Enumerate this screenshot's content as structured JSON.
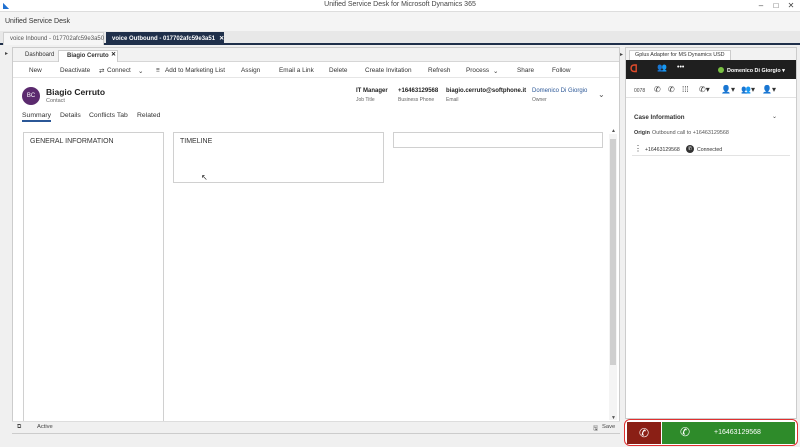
{
  "window": {
    "title": "Unified Service Desk for Microsoft Dynamics 365",
    "app_title": "Unified Service Desk"
  },
  "session_tabs": [
    {
      "label": "voice Inbound - 017702afc59e3a50"
    },
    {
      "label": "voice Outbound - 017702afc59e3a51",
      "close": "✕"
    }
  ],
  "doc_tabs": [
    {
      "label": "Dashboard"
    },
    {
      "label": "Biagio Cerruto",
      "close": "✕"
    }
  ],
  "commands": {
    "new": "New",
    "deactivate": "Deactivate",
    "connect": "Connect",
    "add_marketing": "Add to Marketing List",
    "assign": "Assign",
    "email_link": "Email a Link",
    "delete": "Delete",
    "create_invitation": "Create Invitation",
    "refresh": "Refresh",
    "process": "Process",
    "share": "Share",
    "follow": "Follow"
  },
  "record": {
    "initials": "BC",
    "name": "Biagio Cerruto",
    "type": "Contact",
    "header_fields": [
      {
        "value": "IT Manager",
        "label": "Job Title"
      },
      {
        "value": "+16463129568",
        "label": "Business Phone"
      },
      {
        "value": "biagio.cerruto@softphone.it",
        "label": "Email"
      },
      {
        "value": "Domenico Di Giorgio",
        "label": "Owner"
      }
    ]
  },
  "form_tabs": [
    "Summary",
    "Details",
    "Conflicts Tab",
    "Related"
  ],
  "sections": {
    "general": "GENERAL INFORMATION",
    "timeline": "TIMELINE"
  },
  "status": {
    "state": "Active",
    "save": "Save"
  },
  "right_panel": {
    "tab": "Gplus Adapter for MS Dynamics USD",
    "agent": "Domenico Di Giorgio",
    "toolbar_num": "0078",
    "case_title": "Case Information",
    "origin_label": "Origin",
    "origin_value": "Outbound call to +16463129568",
    "call_number": "+16463129568",
    "call_status": "Connected"
  },
  "callbar": {
    "number": "+16463129568"
  },
  "colors": {
    "accent": "#2b5797",
    "session_active": "#1f2f4a",
    "hangup": "#8a1f15",
    "answer": "#2e8b2a",
    "agent_ready": "#7ac143"
  }
}
